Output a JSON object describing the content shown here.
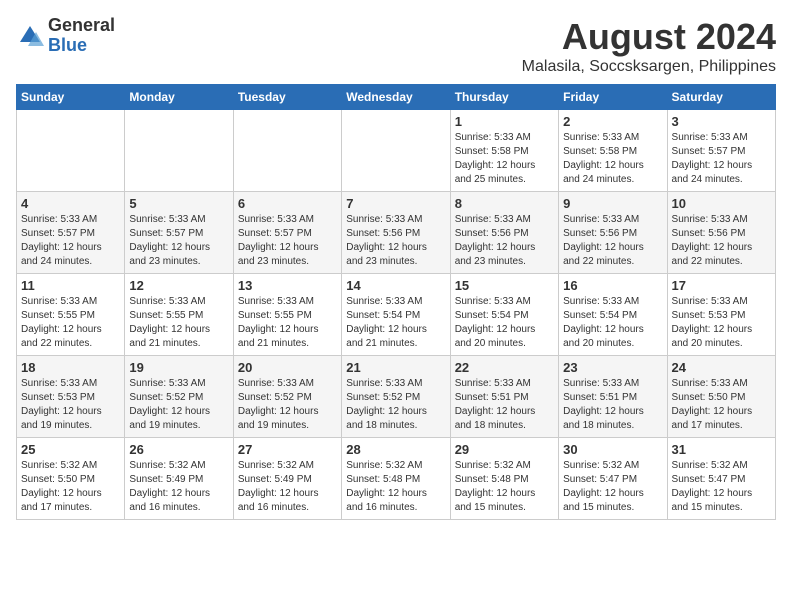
{
  "logo": {
    "general": "General",
    "blue": "Blue"
  },
  "header": {
    "month_year": "August 2024",
    "location": "Malasila, Soccsksargen, Philippines"
  },
  "days_of_week": [
    "Sunday",
    "Monday",
    "Tuesday",
    "Wednesday",
    "Thursday",
    "Friday",
    "Saturday"
  ],
  "weeks": [
    [
      {
        "day": "",
        "info": ""
      },
      {
        "day": "",
        "info": ""
      },
      {
        "day": "",
        "info": ""
      },
      {
        "day": "",
        "info": ""
      },
      {
        "day": "1",
        "info": "Sunrise: 5:33 AM\nSunset: 5:58 PM\nDaylight: 12 hours\nand 25 minutes."
      },
      {
        "day": "2",
        "info": "Sunrise: 5:33 AM\nSunset: 5:58 PM\nDaylight: 12 hours\nand 24 minutes."
      },
      {
        "day": "3",
        "info": "Sunrise: 5:33 AM\nSunset: 5:57 PM\nDaylight: 12 hours\nand 24 minutes."
      }
    ],
    [
      {
        "day": "4",
        "info": "Sunrise: 5:33 AM\nSunset: 5:57 PM\nDaylight: 12 hours\nand 24 minutes."
      },
      {
        "day": "5",
        "info": "Sunrise: 5:33 AM\nSunset: 5:57 PM\nDaylight: 12 hours\nand 23 minutes."
      },
      {
        "day": "6",
        "info": "Sunrise: 5:33 AM\nSunset: 5:57 PM\nDaylight: 12 hours\nand 23 minutes."
      },
      {
        "day": "7",
        "info": "Sunrise: 5:33 AM\nSunset: 5:56 PM\nDaylight: 12 hours\nand 23 minutes."
      },
      {
        "day": "8",
        "info": "Sunrise: 5:33 AM\nSunset: 5:56 PM\nDaylight: 12 hours\nand 23 minutes."
      },
      {
        "day": "9",
        "info": "Sunrise: 5:33 AM\nSunset: 5:56 PM\nDaylight: 12 hours\nand 22 minutes."
      },
      {
        "day": "10",
        "info": "Sunrise: 5:33 AM\nSunset: 5:56 PM\nDaylight: 12 hours\nand 22 minutes."
      }
    ],
    [
      {
        "day": "11",
        "info": "Sunrise: 5:33 AM\nSunset: 5:55 PM\nDaylight: 12 hours\nand 22 minutes."
      },
      {
        "day": "12",
        "info": "Sunrise: 5:33 AM\nSunset: 5:55 PM\nDaylight: 12 hours\nand 21 minutes."
      },
      {
        "day": "13",
        "info": "Sunrise: 5:33 AM\nSunset: 5:55 PM\nDaylight: 12 hours\nand 21 minutes."
      },
      {
        "day": "14",
        "info": "Sunrise: 5:33 AM\nSunset: 5:54 PM\nDaylight: 12 hours\nand 21 minutes."
      },
      {
        "day": "15",
        "info": "Sunrise: 5:33 AM\nSunset: 5:54 PM\nDaylight: 12 hours\nand 20 minutes."
      },
      {
        "day": "16",
        "info": "Sunrise: 5:33 AM\nSunset: 5:54 PM\nDaylight: 12 hours\nand 20 minutes."
      },
      {
        "day": "17",
        "info": "Sunrise: 5:33 AM\nSunset: 5:53 PM\nDaylight: 12 hours\nand 20 minutes."
      }
    ],
    [
      {
        "day": "18",
        "info": "Sunrise: 5:33 AM\nSunset: 5:53 PM\nDaylight: 12 hours\nand 19 minutes."
      },
      {
        "day": "19",
        "info": "Sunrise: 5:33 AM\nSunset: 5:52 PM\nDaylight: 12 hours\nand 19 minutes."
      },
      {
        "day": "20",
        "info": "Sunrise: 5:33 AM\nSunset: 5:52 PM\nDaylight: 12 hours\nand 19 minutes."
      },
      {
        "day": "21",
        "info": "Sunrise: 5:33 AM\nSunset: 5:52 PM\nDaylight: 12 hours\nand 18 minutes."
      },
      {
        "day": "22",
        "info": "Sunrise: 5:33 AM\nSunset: 5:51 PM\nDaylight: 12 hours\nand 18 minutes."
      },
      {
        "day": "23",
        "info": "Sunrise: 5:33 AM\nSunset: 5:51 PM\nDaylight: 12 hours\nand 18 minutes."
      },
      {
        "day": "24",
        "info": "Sunrise: 5:33 AM\nSunset: 5:50 PM\nDaylight: 12 hours\nand 17 minutes."
      }
    ],
    [
      {
        "day": "25",
        "info": "Sunrise: 5:32 AM\nSunset: 5:50 PM\nDaylight: 12 hours\nand 17 minutes."
      },
      {
        "day": "26",
        "info": "Sunrise: 5:32 AM\nSunset: 5:49 PM\nDaylight: 12 hours\nand 16 minutes."
      },
      {
        "day": "27",
        "info": "Sunrise: 5:32 AM\nSunset: 5:49 PM\nDaylight: 12 hours\nand 16 minutes."
      },
      {
        "day": "28",
        "info": "Sunrise: 5:32 AM\nSunset: 5:48 PM\nDaylight: 12 hours\nand 16 minutes."
      },
      {
        "day": "29",
        "info": "Sunrise: 5:32 AM\nSunset: 5:48 PM\nDaylight: 12 hours\nand 15 minutes."
      },
      {
        "day": "30",
        "info": "Sunrise: 5:32 AM\nSunset: 5:47 PM\nDaylight: 12 hours\nand 15 minutes."
      },
      {
        "day": "31",
        "info": "Sunrise: 5:32 AM\nSunset: 5:47 PM\nDaylight: 12 hours\nand 15 minutes."
      }
    ]
  ]
}
